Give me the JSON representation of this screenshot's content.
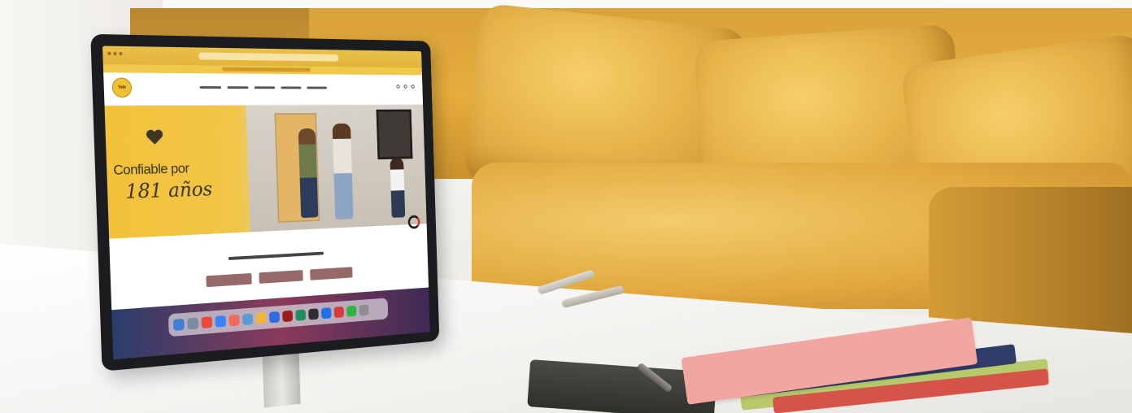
{
  "hero": {
    "line1": "Confiable por",
    "line2": "181 años"
  },
  "site": {
    "logo_text": "Yale"
  },
  "colors": {
    "brand_yellow": "#f2c23a",
    "sofa": "#e2aa40",
    "frame": "#1b1c1f"
  },
  "icons": [
    "heart-icon",
    "search-icon",
    "user-icon",
    "cart-icon",
    "brand-badge-icon"
  ]
}
